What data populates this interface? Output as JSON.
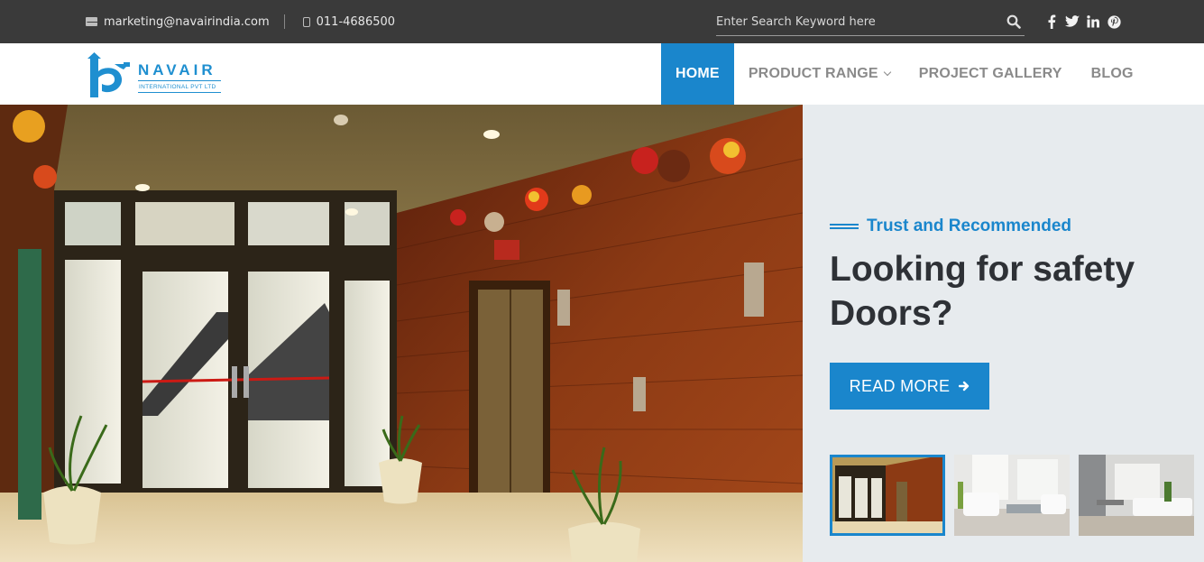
{
  "topbar": {
    "email": "marketing@navairindia.com",
    "phone": "011-4686500",
    "search_placeholder": "Enter Search Keyword here",
    "icons": [
      "envelope-icon",
      "mobile-icon",
      "search-icon",
      "facebook-icon",
      "twitter-icon",
      "linkedin-icon",
      "pinterest-icon"
    ]
  },
  "header": {
    "logo": {
      "wordmark": "NAVAIR",
      "sub": "INTERNATIONAL PVT LTD"
    },
    "nav": [
      {
        "label": "HOME",
        "active": true
      },
      {
        "label": "PRODUCT RANGE",
        "active": false,
        "dropdown": true
      },
      {
        "label": "PROJECT GALLERY",
        "active": false
      },
      {
        "label": "BLOG",
        "active": false
      }
    ]
  },
  "hero": {
    "kicker": "Trust and Recommended",
    "headline_line1": "Looking for safety",
    "headline_line2": "Doors?",
    "cta_label": "READ MORE",
    "thumbnails": [
      {
        "name": "lobby-thumbnail",
        "active": true
      },
      {
        "name": "white-living-room-thumbnail",
        "active": false
      },
      {
        "name": "grey-living-room-thumbnail",
        "active": false
      }
    ]
  },
  "colors": {
    "accent": "#1a86cc",
    "topbar_bg": "#3a3a3a",
    "hero_side_bg": "#e7ebee",
    "headline": "#2e3136",
    "nav_text": "#8a8a8a"
  }
}
